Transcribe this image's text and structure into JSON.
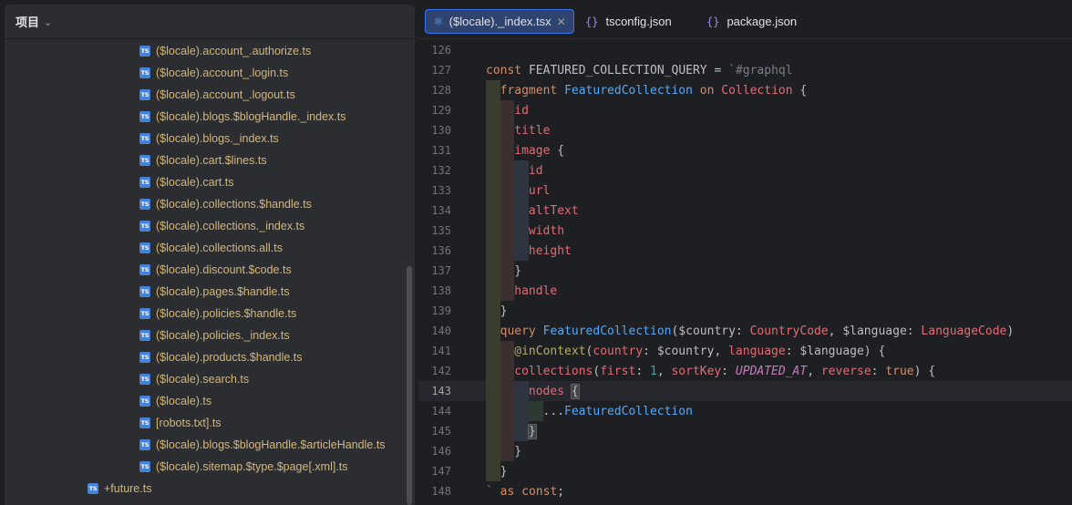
{
  "project_panel": {
    "title": "项目",
    "files": [
      {
        "name": "($locale).account_.authorize.ts",
        "depth": 2
      },
      {
        "name": "($locale).account_.login.ts",
        "depth": 2
      },
      {
        "name": "($locale).account_.logout.ts",
        "depth": 2
      },
      {
        "name": "($locale).blogs.$blogHandle._index.ts",
        "depth": 2
      },
      {
        "name": "($locale).blogs._index.ts",
        "depth": 2
      },
      {
        "name": "($locale).cart.$lines.ts",
        "depth": 2
      },
      {
        "name": "($locale).cart.ts",
        "depth": 2
      },
      {
        "name": "($locale).collections.$handle.ts",
        "depth": 2
      },
      {
        "name": "($locale).collections._index.ts",
        "depth": 2
      },
      {
        "name": "($locale).collections.all.ts",
        "depth": 2
      },
      {
        "name": "($locale).discount.$code.ts",
        "depth": 2
      },
      {
        "name": "($locale).pages.$handle.ts",
        "depth": 2
      },
      {
        "name": "($locale).policies.$handle.ts",
        "depth": 2
      },
      {
        "name": "($locale).policies._index.ts",
        "depth": 2
      },
      {
        "name": "($locale).products.$handle.ts",
        "depth": 2
      },
      {
        "name": "($locale).search.ts",
        "depth": 2
      },
      {
        "name": "($locale).ts",
        "depth": 2
      },
      {
        "name": "[robots.txt].ts",
        "depth": 2
      },
      {
        "name": "($locale).blogs.$blogHandle.$articleHandle.ts",
        "depth": 2
      },
      {
        "name": "($locale).sitemap.$type.$page[.xml].ts",
        "depth": 2
      },
      {
        "name": "+future.ts",
        "depth": 1
      }
    ],
    "file_icon": "typescript-icon",
    "ts_badge": "TS"
  },
  "tabs": [
    {
      "label": "($locale)._index.tsx",
      "icon": "react-icon",
      "active": true,
      "closable": true
    },
    {
      "label": "tsconfig.json",
      "icon": "json-icon",
      "active": false
    },
    {
      "label": "package.json",
      "icon": "json-icon",
      "active": false
    }
  ],
  "editor": {
    "current_line": 143,
    "lines": [
      {
        "n": 126,
        "indent": 0,
        "tokens": []
      },
      {
        "n": 127,
        "indent": 0,
        "tokens": [
          [
            "kw",
            "const "
          ],
          [
            "plain",
            "FEATURED_COLLECTION_QUERY = "
          ],
          [
            "cmt",
            "`#graphql"
          ]
        ]
      },
      {
        "n": 128,
        "indent": 1,
        "tokens": [
          [
            "kw",
            "fragment "
          ],
          [
            "frag",
            "FeaturedCollection "
          ],
          [
            "kw",
            "on "
          ],
          [
            "coll",
            "Collection"
          ],
          [
            "plain",
            " {"
          ]
        ]
      },
      {
        "n": 129,
        "indent": 2,
        "tokens": [
          [
            "fld",
            "id"
          ]
        ]
      },
      {
        "n": 130,
        "indent": 2,
        "tokens": [
          [
            "fld",
            "title"
          ]
        ]
      },
      {
        "n": 131,
        "indent": 2,
        "tokens": [
          [
            "fld",
            "image"
          ],
          [
            "plain",
            " {"
          ]
        ]
      },
      {
        "n": 132,
        "indent": 3,
        "tokens": [
          [
            "fld",
            "id"
          ]
        ]
      },
      {
        "n": 133,
        "indent": 3,
        "tokens": [
          [
            "fld",
            "url"
          ]
        ]
      },
      {
        "n": 134,
        "indent": 3,
        "tokens": [
          [
            "fld",
            "altText"
          ]
        ]
      },
      {
        "n": 135,
        "indent": 3,
        "tokens": [
          [
            "fld",
            "width"
          ]
        ]
      },
      {
        "n": 136,
        "indent": 3,
        "tokens": [
          [
            "fld",
            "height"
          ]
        ]
      },
      {
        "n": 137,
        "indent": 2,
        "tokens": [
          [
            "plain",
            "}"
          ]
        ]
      },
      {
        "n": 138,
        "indent": 2,
        "tokens": [
          [
            "fld",
            "handle"
          ]
        ]
      },
      {
        "n": 139,
        "indent": 1,
        "tokens": [
          [
            "plain",
            "}"
          ]
        ]
      },
      {
        "n": 140,
        "indent": 1,
        "tokens": [
          [
            "kw",
            "query "
          ],
          [
            "frag",
            "FeaturedCollection"
          ],
          [
            "plain",
            "($country: "
          ],
          [
            "typ",
            "CountryCode"
          ],
          [
            "plain",
            ", $language: "
          ],
          [
            "typ",
            "LanguageCode"
          ],
          [
            "plain",
            ")"
          ]
        ]
      },
      {
        "n": 141,
        "indent": 2,
        "tokens": [
          [
            "dir",
            "@inContext"
          ],
          [
            "plain",
            "("
          ],
          [
            "fld",
            "country"
          ],
          [
            "plain",
            ": $country, "
          ],
          [
            "fld",
            "language"
          ],
          [
            "plain",
            ": $language) {"
          ]
        ]
      },
      {
        "n": 142,
        "indent": 2,
        "tokens": [
          [
            "fld",
            "collections"
          ],
          [
            "plain",
            "("
          ],
          [
            "fld",
            "first"
          ],
          [
            "plain",
            ": "
          ],
          [
            "num",
            "1"
          ],
          [
            "plain",
            ", "
          ],
          [
            "fld",
            "sortKey"
          ],
          [
            "plain",
            ": "
          ],
          [
            "enm",
            "UPDATED_AT"
          ],
          [
            "plain",
            ", "
          ],
          [
            "fld",
            "reverse"
          ],
          [
            "plain",
            ": "
          ],
          [
            "kw",
            "true"
          ],
          [
            "plain",
            ") {"
          ]
        ]
      },
      {
        "n": 143,
        "indent": 3,
        "tokens": [
          [
            "fld",
            "nodes"
          ],
          [
            "plain",
            " "
          ],
          [
            "brace",
            "{"
          ]
        ]
      },
      {
        "n": 144,
        "indent": 4,
        "tokens": [
          [
            "plain",
            "..."
          ],
          [
            "frag",
            "FeaturedCollection"
          ]
        ]
      },
      {
        "n": 145,
        "indent": 3,
        "tokens": [
          [
            "brace",
            "}"
          ]
        ]
      },
      {
        "n": 146,
        "indent": 2,
        "tokens": [
          [
            "plain",
            "}"
          ]
        ]
      },
      {
        "n": 147,
        "indent": 1,
        "tokens": [
          [
            "plain",
            "}"
          ]
        ]
      },
      {
        "n": 148,
        "indent": 0,
        "tokens": [
          [
            "cmt",
            "` "
          ],
          [
            "kw",
            "as const"
          ],
          [
            "plain",
            ";"
          ]
        ]
      }
    ]
  }
}
